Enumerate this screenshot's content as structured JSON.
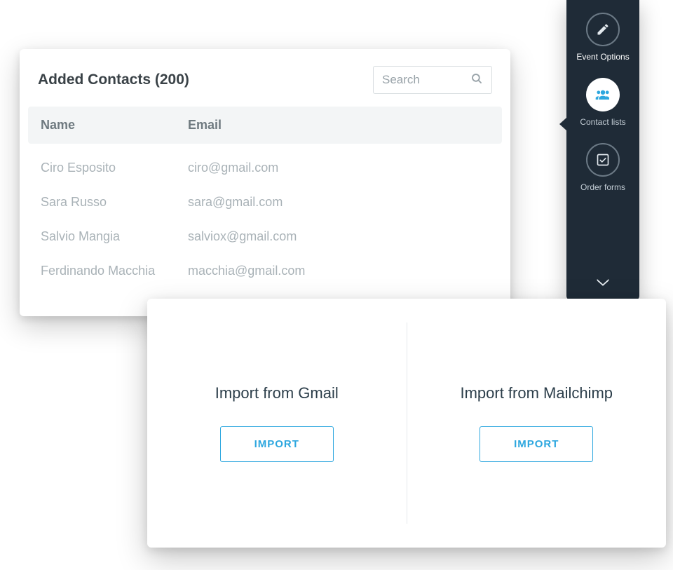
{
  "contacts": {
    "title": "Added Contacts (200)",
    "search_placeholder": "Search",
    "columns": {
      "name": "Name",
      "email": "Email"
    },
    "rows": [
      {
        "name": "Ciro Esposito",
        "email": "ciro@gmail.com"
      },
      {
        "name": "Sara Russo",
        "email": "sara@gmail.com"
      },
      {
        "name": "Salvio Mangia",
        "email": "salviox@gmail.com"
      },
      {
        "name": "Ferdinando Macchia",
        "email": "macchia@gmail.com"
      }
    ]
  },
  "sidebar": {
    "items": [
      {
        "icon": "pencil-icon",
        "label": "Event Options",
        "active": false
      },
      {
        "icon": "users-icon",
        "label": "Contact lists",
        "active": true
      },
      {
        "icon": "checkbox-icon",
        "label": "Order forms",
        "active": false
      }
    ]
  },
  "import": {
    "options": [
      {
        "title": "Import from Gmail",
        "button": "IMPORT"
      },
      {
        "title": "Import from Mailchimp",
        "button": "IMPORT"
      }
    ]
  }
}
